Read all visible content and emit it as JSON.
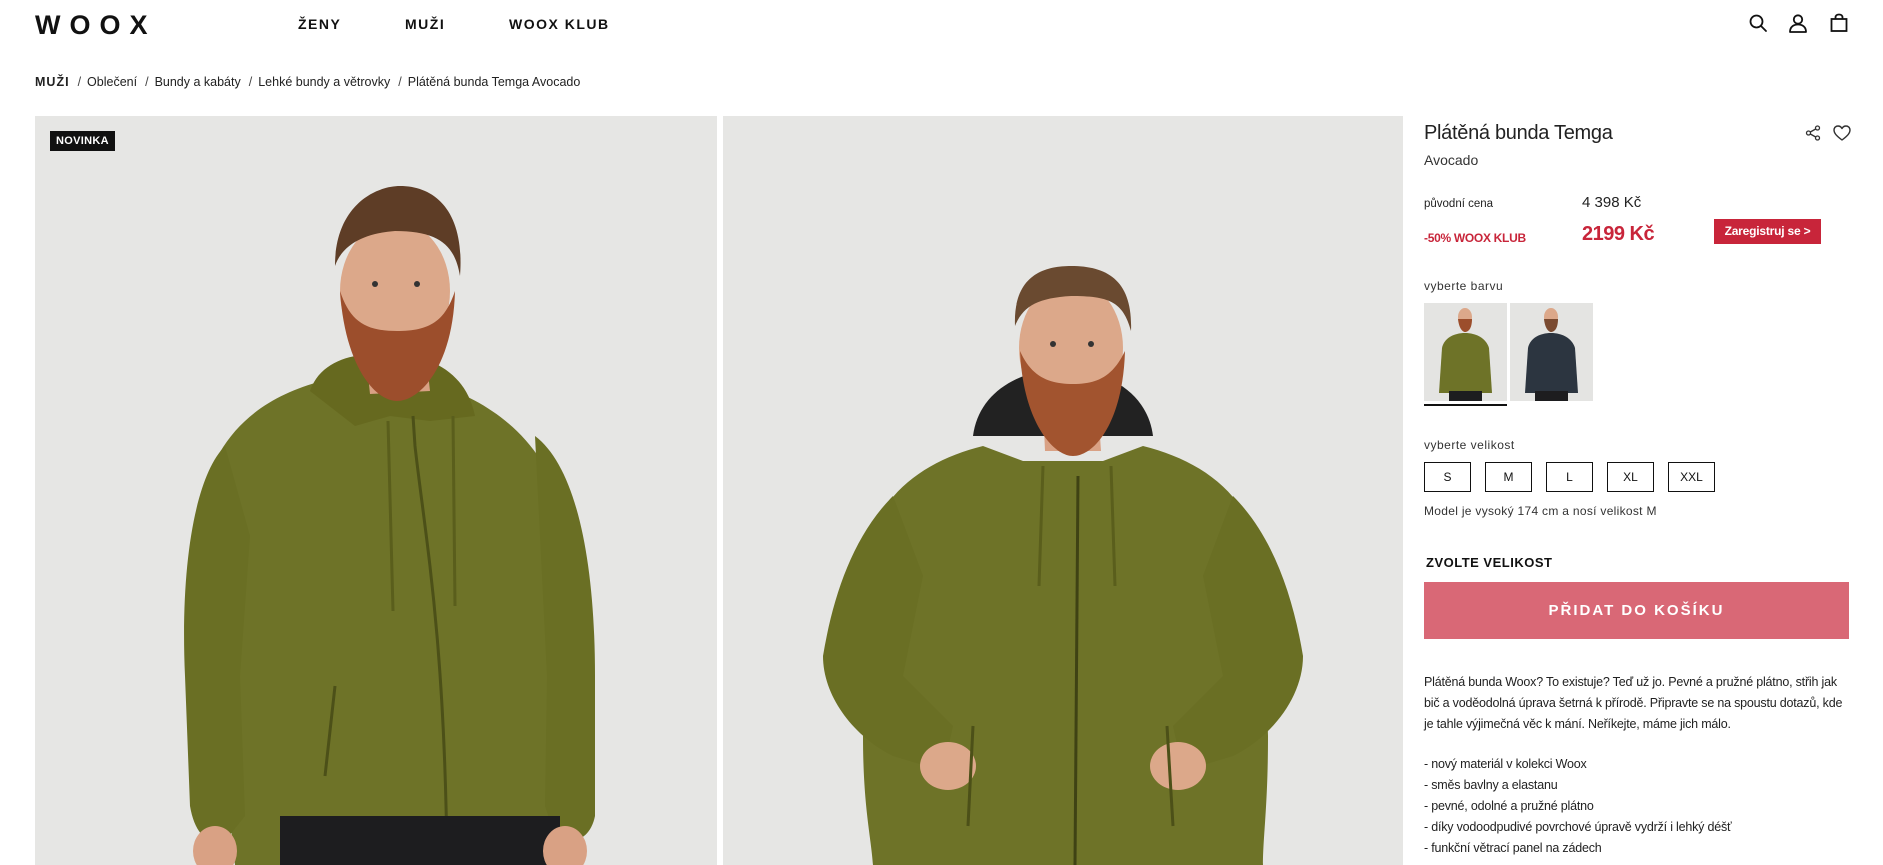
{
  "header": {
    "logo": "WOOX",
    "nav": [
      "ŽENY",
      "MUŽI",
      "WOOX KLUB"
    ],
    "icons": [
      "search-icon",
      "user-icon",
      "shopping-bag-icon"
    ]
  },
  "breadcrumb": {
    "root": "MUŽI",
    "items": [
      "Oblečení",
      "Bundy a kabáty",
      "Lehké bundy a větrovky",
      "Plátěná bunda Temga Avocado"
    ]
  },
  "gallery": {
    "badge": "NOVINKA"
  },
  "product": {
    "title": "Plátěná bunda Temga",
    "color_name": "Avocado",
    "original_price_label": "původní cena",
    "original_price": "4 398 Kč",
    "club_label": "-50% WOOX KLUB",
    "club_price": "2199 Kč",
    "register_label": "Zaregistruj se >",
    "color_label": "vyberte barvu",
    "size_label": "vyberte  velikost",
    "sizes": [
      "S",
      "M",
      "L",
      "XL",
      "XXL"
    ],
    "model_note": "Model je vysoký 174 cm a nosí velikost M",
    "choose_size": "ZVOLTE VELIKOST",
    "add_to_cart": "PŘIDAT DO KOŠÍKU",
    "description": "Plátěná bunda Woox? To existuje? Teď už jo. Pevné a pružné plátno, střih jak bič a voděodolná úprava šetrná k přírodě. Připravte se na spoustu dotazů, kde je tahle výjimečná věc k mání. Neříkejte, máme jich málo.",
    "features": [
      "- nový materiál v kolekci Woox",
      "- směs bavlny a elastanu",
      "- pevné, odolné a pružné plátno",
      "- díky vodoodpudivé povrchové úpravě vydrží i lehký déšť",
      "- funkční větrací panel na zádech"
    ]
  },
  "colors": {
    "jacket_olive": "#6e7328",
    "jacket_navy": "#2c3540",
    "club_red": "#c8253a",
    "cart_pink": "#d96876"
  }
}
